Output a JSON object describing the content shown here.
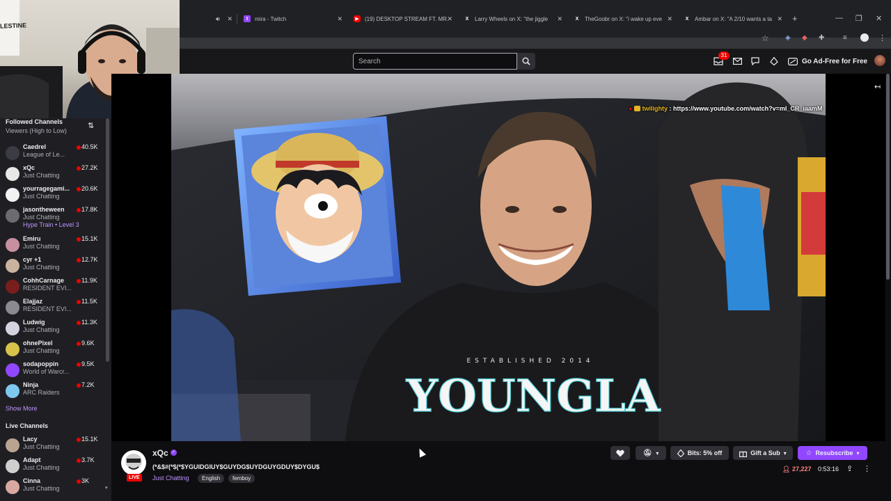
{
  "browser": {
    "tabs": [
      {
        "label": "mira - Twitch",
        "icon": "twitch-icon"
      },
      {
        "label": "(19) DESKTOP STREAM FT. MR.",
        "icon": "youtube-icon"
      },
      {
        "label": "Larry Wheels on X: \"the jiggle",
        "icon": "x-icon"
      },
      {
        "label": "TheGoobr on X: \"i wake up eve",
        "icon": "x-icon"
      },
      {
        "label": "Ambar on X: \"A 2/10 wants a ta",
        "icon": "x-icon"
      }
    ]
  },
  "header": {
    "search_placeholder": "Search",
    "notification_count": "31",
    "ad_free_label": "Go Ad-Free for Free"
  },
  "sidebar": {
    "followed_title": "Followed Channels",
    "sort_label": "Viewers (High to Low)",
    "followed": [
      {
        "name": "Caedrel",
        "game": "League of Le...",
        "viewers": "40.5K",
        "color": "#3b3b44"
      },
      {
        "name": "xQc",
        "game": "Just Chatting",
        "viewers": "27.2K",
        "color": "#e8e8e8"
      },
      {
        "name": "yourragegami...",
        "game": "Just Chatting",
        "viewers": "20.6K",
        "color": "#f2f2f2"
      },
      {
        "name": "jasontheween",
        "game": "Just Chatting",
        "extra": "Hype Train • Level 3",
        "viewers": "17.8K",
        "color": "#6b6b70"
      },
      {
        "name": "Emiru",
        "game": "Just Chatting",
        "viewers": "15.1K",
        "color": "#c88fa0"
      },
      {
        "name": "cyr +1",
        "game": "Just Chatting",
        "viewers": "12.7K",
        "color": "#c9b3a0"
      },
      {
        "name": "CohhCarnage",
        "game": "RESIDENT EVI...",
        "viewers": "11.9K",
        "color": "#7a1d1d"
      },
      {
        "name": "Elajjaz",
        "game": "RESIDENT EVI...",
        "viewers": "11.5K",
        "color": "#8a8a90"
      },
      {
        "name": "Ludwig",
        "game": "Just Chatting",
        "viewers": "11.3K",
        "color": "#d4d4e0"
      },
      {
        "name": "ohnePixel",
        "game": "Just Chatting",
        "viewers": "9.6K",
        "color": "#d9c24a"
      },
      {
        "name": "sodapoppin",
        "game": "World of Warcr...",
        "viewers": "9.5K",
        "color": "#9147ff"
      },
      {
        "name": "Ninja",
        "game": "ARC Raiders",
        "viewers": "7.2K",
        "color": "#7ec8f0"
      }
    ],
    "show_more": "Show More",
    "live_title": "Live Channels",
    "live": [
      {
        "name": "Lacy",
        "game": "Just Chatting",
        "viewers": "15.1K",
        "color": "#b9a58f"
      },
      {
        "name": "Adapt",
        "game": "Just Chatting",
        "viewers": "3.7K",
        "color": "#cfcfcf"
      },
      {
        "name": "Cinna",
        "game": "Just Chatting",
        "viewers": "3K",
        "color": "#d8a8a0"
      }
    ]
  },
  "video": {
    "chat_user": "twilighty",
    "chat_message": ": https://www.youtube.com/watch?v=mI_CR_iaamM",
    "hoodie_text": "YOUNGLA",
    "hoodie_subtext": "ESTABLISHED 2014"
  },
  "channel": {
    "name": "xQc",
    "live_label": "LIVE",
    "title": "(*&$#(*$(*$YGUIDGIUY$GUYDG$UYDGUYGDUY$DYGU$",
    "game": "Just Chatting",
    "tags": [
      "English",
      "femboy"
    ],
    "bits_label": "Bits: 5% off",
    "gift_label": "Gift a Sub",
    "resub_label": "Resubscribe",
    "viewers": "27,227",
    "uptime": "0:53:16"
  },
  "webcam": {
    "banner_text": "LESTINE"
  },
  "colors": {
    "accent": "#9147ff",
    "live": "#eb0400",
    "link": "#bf94ff",
    "bg": "#0e0e10"
  }
}
